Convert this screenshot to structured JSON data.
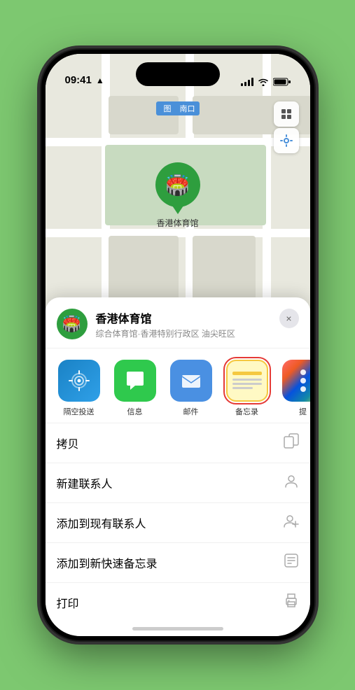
{
  "status_bar": {
    "time": "09:41",
    "location_arrow": "▲"
  },
  "map": {
    "label": "南口",
    "pin_label": "香港体育馆"
  },
  "venue_card": {
    "name": "香港体育馆",
    "subtitle": "综合体育馆·香港特别行政区 油尖旺区",
    "close_label": "×"
  },
  "share_items": [
    {
      "id": "airdrop",
      "label": "隔空投送",
      "type": "airdrop"
    },
    {
      "id": "message",
      "label": "信息",
      "type": "message"
    },
    {
      "id": "mail",
      "label": "邮件",
      "type": "mail"
    },
    {
      "id": "notes",
      "label": "备忘录",
      "type": "notes"
    },
    {
      "id": "more",
      "label": "提",
      "type": "more"
    }
  ],
  "actions": [
    {
      "id": "copy",
      "label": "拷贝",
      "icon": "copy"
    },
    {
      "id": "new-contact",
      "label": "新建联系人",
      "icon": "person"
    },
    {
      "id": "add-existing",
      "label": "添加到现有联系人",
      "icon": "person-add"
    },
    {
      "id": "add-notes",
      "label": "添加到新快速备忘录",
      "icon": "note"
    },
    {
      "id": "print",
      "label": "打印",
      "icon": "print"
    }
  ]
}
